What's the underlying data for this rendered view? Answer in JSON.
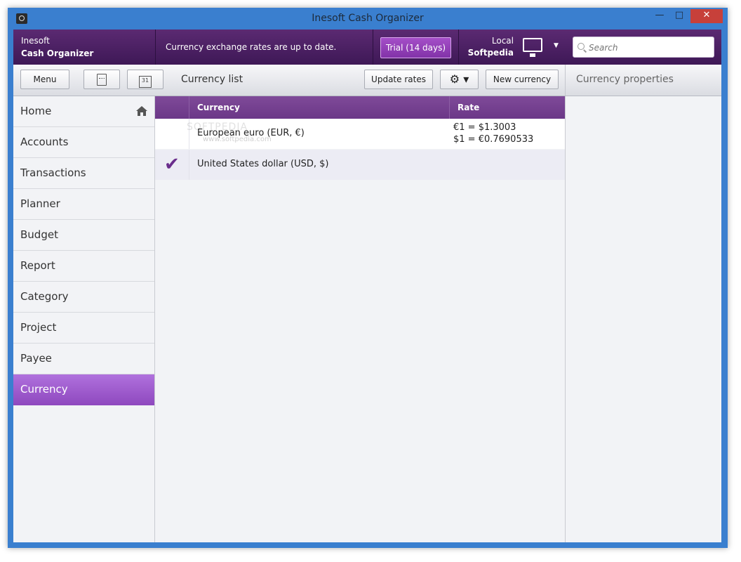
{
  "window": {
    "title": "Inesoft Cash Organizer",
    "minimize_glyph": "—",
    "maximize_glyph": "□",
    "close_glyph": "✕"
  },
  "header": {
    "brand_line1": "Inesoft",
    "brand_line2": "Cash Organizer",
    "status": "Currency exchange rates are up to date.",
    "trial_label": "Trial (14 days)",
    "profile_line1": "Local",
    "profile_line2": "Softpedia",
    "search_placeholder": "Search"
  },
  "toolbar": {
    "menu_label": "Menu",
    "calendar_day": "31",
    "list_title": "Currency list",
    "update_label": "Update rates",
    "gear_glyph": "⚙",
    "gear_caret": "▾",
    "new_label": "New currency",
    "props_title": "Currency properties"
  },
  "sidebar": {
    "items": [
      {
        "label": "Home"
      },
      {
        "label": "Accounts"
      },
      {
        "label": "Transactions"
      },
      {
        "label": "Planner"
      },
      {
        "label": "Budget"
      },
      {
        "label": "Report"
      },
      {
        "label": "Category"
      },
      {
        "label": "Project"
      },
      {
        "label": "Payee"
      },
      {
        "label": "Currency"
      }
    ],
    "active_index": 9
  },
  "grid": {
    "columns": [
      "Currency",
      "Rate"
    ],
    "rows": [
      {
        "name": "European euro (EUR, €)",
        "rate_line1": "€1 = $1.3003",
        "rate_line2": "$1 = €0.7690533",
        "is_base": false
      },
      {
        "name": "United States dollar (USD, $)",
        "rate_line1": "",
        "rate_line2": "",
        "is_base": true
      }
    ],
    "watermark_line1": "SOFTPEDIA",
    "watermark_line2": "www.softpedia.com"
  },
  "colors": {
    "header_purple": "#4a1f63",
    "accent_purple": "#9e5bd0",
    "check_purple": "#6a2d8c",
    "window_blue": "#3a7fcf"
  }
}
